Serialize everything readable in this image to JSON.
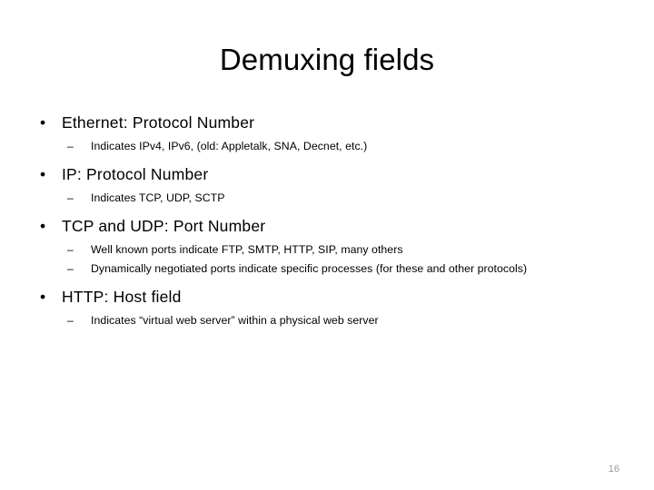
{
  "slide": {
    "title": "Demuxing fields",
    "page_number": "16",
    "bullet_marker": "•",
    "sub_bullet_marker": "–",
    "groups": [
      {
        "heading": "Ethernet:  Protocol Number",
        "subs": [
          "Indicates IPv4, IPv6, (old: Appletalk, SNA, Decnet, etc.)"
        ]
      },
      {
        "heading": "IP:  Protocol Number",
        "subs": [
          "Indicates TCP, UDP, SCTP"
        ]
      },
      {
        "heading": "TCP and UDP:  Port Number",
        "subs": [
          "Well known ports indicate FTP, SMTP, HTTP, SIP, many others",
          "Dynamically negotiated ports indicate specific processes (for these and other protocols)"
        ]
      },
      {
        "heading": "HTTP:  Host field",
        "subs": [
          "Indicates “virtual web server” within a physical web server"
        ]
      }
    ]
  }
}
